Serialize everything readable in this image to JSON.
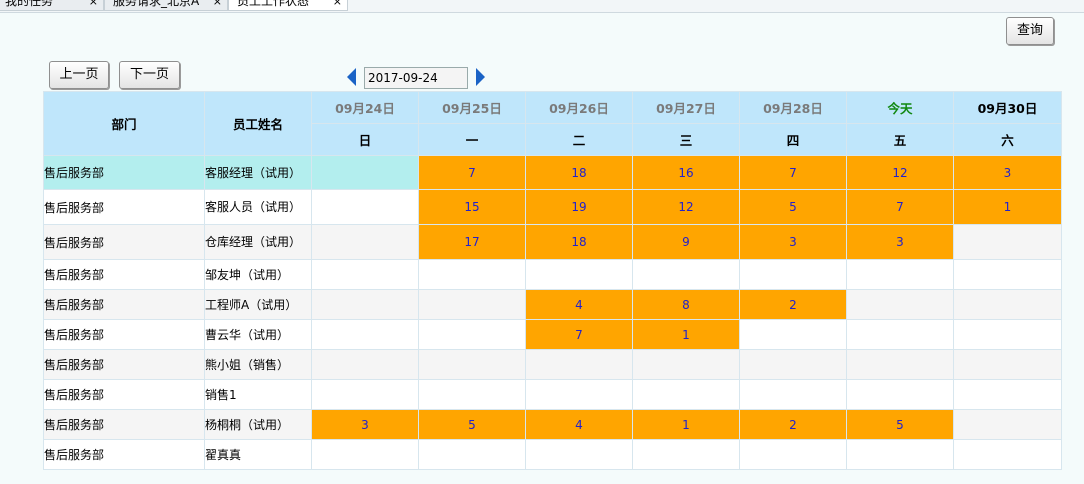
{
  "tabs": [
    {
      "label": "我的任务"
    },
    {
      "label": "服务请求_北京A"
    },
    {
      "label": "员工工作状态"
    }
  ],
  "tab_close_glyph": "×",
  "toolbar": {
    "query_label": "查询",
    "prev_label": "上一页",
    "next_label": "下一页",
    "date_value": "2017-09-24"
  },
  "table": {
    "col_dept": "部门",
    "col_name": "员工姓名",
    "days": [
      {
        "date": "09月24日",
        "weekday": "日",
        "state": "past"
      },
      {
        "date": "09月25日",
        "weekday": "一",
        "state": "past"
      },
      {
        "date": "09月26日",
        "weekday": "二",
        "state": "past"
      },
      {
        "date": "09月27日",
        "weekday": "三",
        "state": "past"
      },
      {
        "date": "09月28日",
        "weekday": "四",
        "state": "past"
      },
      {
        "date": "今天",
        "weekday": "五",
        "state": "today"
      },
      {
        "date": "09月30日",
        "weekday": "六",
        "state": "future"
      }
    ],
    "rows": [
      {
        "dept": "售后服务部",
        "name": "客服经理（试用）",
        "cells": [
          "",
          "7",
          "18",
          "16",
          "7",
          "12",
          "3"
        ]
      },
      {
        "dept": "售后服务部",
        "name": "客服人员（试用）",
        "cells": [
          "",
          "15",
          "19",
          "12",
          "5",
          "7",
          "1"
        ]
      },
      {
        "dept": "售后服务部",
        "name": "仓库经理（试用）",
        "cells": [
          "",
          "17",
          "18",
          "9",
          "3",
          "3",
          ""
        ]
      },
      {
        "dept": "售后服务部",
        "name": "邹友坤（试用）",
        "cells": [
          "",
          "",
          "",
          "",
          "",
          "",
          ""
        ]
      },
      {
        "dept": "售后服务部",
        "name": "工程师A（试用）",
        "cells": [
          "",
          "",
          "4",
          "8",
          "2",
          "",
          ""
        ]
      },
      {
        "dept": "售后服务部",
        "name": "曹云华（试用）",
        "cells": [
          "",
          "",
          "7",
          "1",
          "",
          "",
          ""
        ]
      },
      {
        "dept": "售后服务部",
        "name": "熊小姐（销售）",
        "cells": [
          "",
          "",
          "",
          "",
          "",
          "",
          ""
        ]
      },
      {
        "dept": "售后服务部",
        "name": "销售1",
        "cells": [
          "",
          "",
          "",
          "",
          "",
          "",
          ""
        ]
      },
      {
        "dept": "售后服务部",
        "name": "杨桐桐（试用）",
        "cells": [
          "3",
          "5",
          "4",
          "1",
          "2",
          "5",
          ""
        ]
      },
      {
        "dept": "售后服务部",
        "name": "翟真真",
        "cells": [
          "",
          "",
          "",
          "",
          "",
          "",
          ""
        ]
      }
    ]
  },
  "colors": {
    "busy": "#ffa500",
    "header": "#bfe6fb",
    "selected": "#b3eeee",
    "today": "#118811"
  }
}
